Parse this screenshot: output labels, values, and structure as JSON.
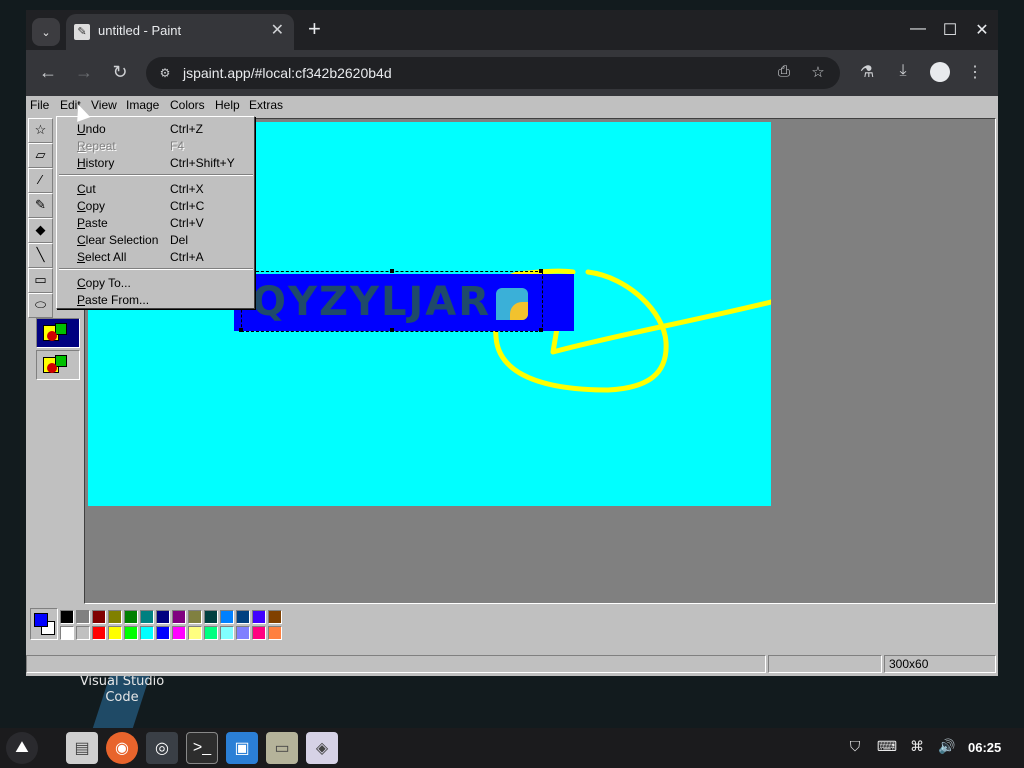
{
  "desktop": {
    "icon_label_line1": "Visual Studio",
    "icon_label_line2": "Code"
  },
  "browser": {
    "tab_title": "untitled - Paint",
    "url": "jspaint.app/#local:cf342b2620b4d",
    "new_tab": "+",
    "close_tab": "✕",
    "tab_list": "⌄",
    "minimize": "—",
    "maximize": "☐",
    "close": "✕"
  },
  "paint": {
    "menus": [
      "File",
      "Edit",
      "View",
      "Image",
      "Colors",
      "Help",
      "Extras"
    ],
    "edit_menu": {
      "items": [
        {
          "label": "Undo",
          "shortcut": "Ctrl+Z",
          "enabled": true
        },
        {
          "label": "Repeat",
          "shortcut": "F4",
          "enabled": false
        },
        {
          "label": "History",
          "shortcut": "Ctrl+Shift+Y",
          "enabled": true
        },
        {
          "label": "Cut",
          "shortcut": "Ctrl+X",
          "enabled": true
        },
        {
          "label": "Copy",
          "shortcut": "Ctrl+C",
          "enabled": true
        },
        {
          "label": "Paste",
          "shortcut": "Ctrl+V",
          "enabled": true
        },
        {
          "label": "Clear Selection",
          "shortcut": "Del",
          "enabled": true
        },
        {
          "label": "Select All",
          "shortcut": "Ctrl+A",
          "enabled": true
        },
        {
          "label": "Copy To...",
          "shortcut": "",
          "enabled": true
        },
        {
          "label": "Paste From...",
          "shortcut": "",
          "enabled": true
        }
      ]
    },
    "canvas": {
      "background": "#00ffff",
      "logo_text": "QYZYLJAR"
    },
    "colors": {
      "foreground": "#0000ff",
      "background": "#ffffff",
      "palette_row1": [
        "#000000",
        "#808080",
        "#800000",
        "#808000",
        "#008000",
        "#008080",
        "#000080",
        "#800080",
        "#808040",
        "#004040",
        "#0080ff",
        "#004080",
        "#4000ff",
        "#804000"
      ],
      "palette_row2": [
        "#ffffff",
        "#c0c0c0",
        "#ff0000",
        "#ffff00",
        "#00ff00",
        "#00ffff",
        "#0000ff",
        "#ff00ff",
        "#ffff80",
        "#00ff80",
        "#80ffff",
        "#8080ff",
        "#ff0080",
        "#ff8040"
      ]
    },
    "status": {
      "text": "",
      "position": "",
      "size": "300x60"
    }
  },
  "taskbar": {
    "clock": "06:25",
    "apps": [
      "files-app",
      "firefox",
      "chromium",
      "terminal",
      "store",
      "file-manager",
      "paint-app"
    ]
  }
}
